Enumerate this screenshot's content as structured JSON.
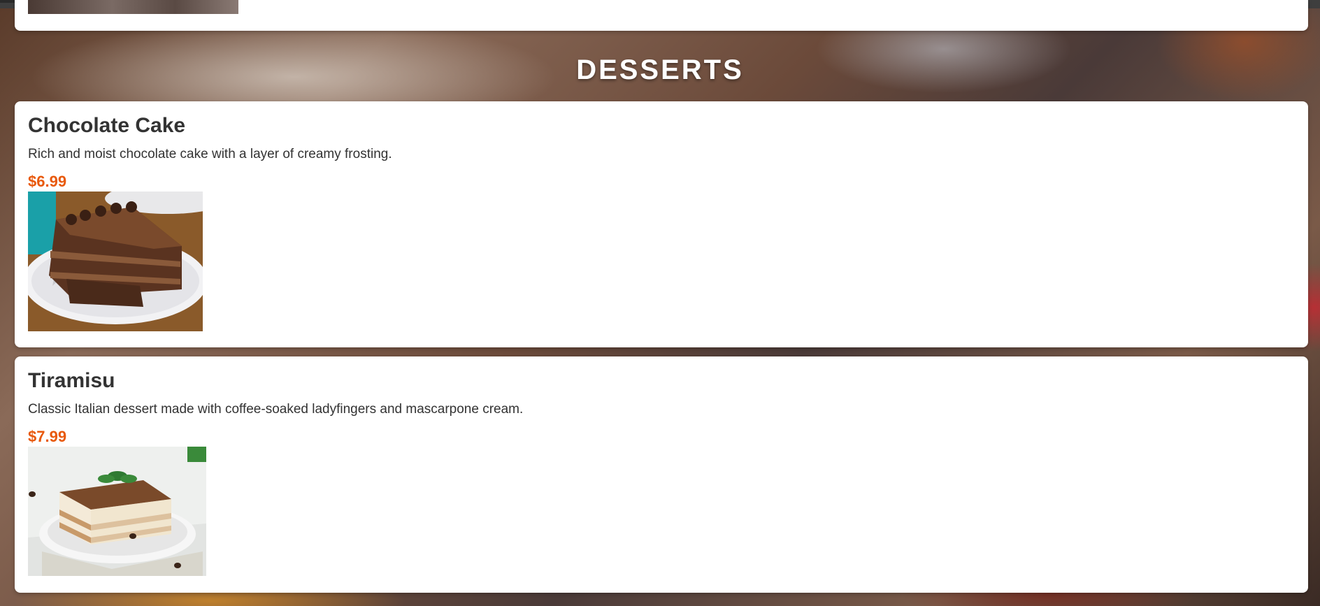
{
  "section": {
    "title": "DESSERTS"
  },
  "colors": {
    "price": "#e8590c",
    "card_background": "#ffffff",
    "text": "#333333"
  },
  "items": [
    {
      "name": "Chocolate Cake",
      "description": "Rich and moist chocolate cake with a layer of creamy frosting.",
      "price": "$6.99",
      "image_icon": "chocolate-cake-photo"
    },
    {
      "name": "Tiramisu",
      "description": "Classic Italian dessert made with coffee-soaked ladyfingers and mascarpone cream.",
      "price": "$7.99",
      "image_icon": "tiramisu-photo"
    }
  ]
}
